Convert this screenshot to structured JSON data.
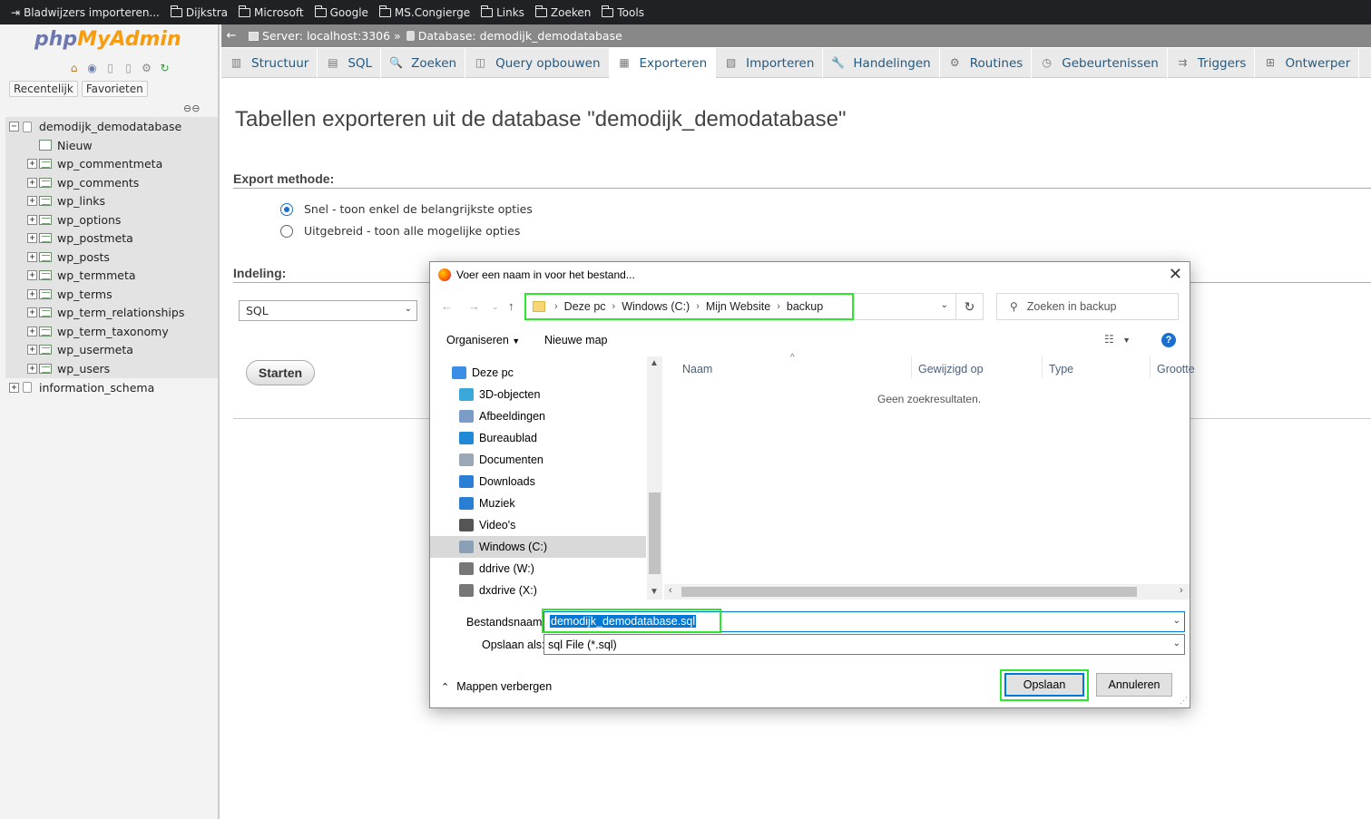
{
  "bookmarks": [
    {
      "label": "Bladwijzers importeren...",
      "icon": "import-icon"
    },
    {
      "label": "Dijkstra",
      "icon": "folder-icon"
    },
    {
      "label": "Microsoft",
      "icon": "folder-icon"
    },
    {
      "label": "Google",
      "icon": "folder-icon"
    },
    {
      "label": "MS.Congierge",
      "icon": "folder-icon"
    },
    {
      "label": "Links",
      "icon": "folder-icon"
    },
    {
      "label": "Zoeken",
      "icon": "folder-icon"
    },
    {
      "label": "Tools",
      "icon": "folder-icon"
    }
  ],
  "sidebar": {
    "logo_php": "php",
    "logo_myadmin": "MyAdmin",
    "tabs": [
      "Recentelijk",
      "Favorieten"
    ],
    "db_selected": "demodijk_demodatabase",
    "new_label": "Nieuw",
    "tables": [
      "wp_commentmeta",
      "wp_comments",
      "wp_links",
      "wp_options",
      "wp_postmeta",
      "wp_posts",
      "wp_termmeta",
      "wp_terms",
      "wp_term_relationships",
      "wp_term_taxonomy",
      "wp_usermeta",
      "wp_users"
    ],
    "db_other": "information_schema"
  },
  "breadcrumb": {
    "server": "Server: localhost:3306",
    "sep": "»",
    "database": "Database: demodijk_demodatabase"
  },
  "tabs": [
    {
      "label": "Structuur",
      "icon": "structure-icon"
    },
    {
      "label": "SQL",
      "icon": "sql-icon"
    },
    {
      "label": "Zoeken",
      "icon": "search-icon"
    },
    {
      "label": "Query opbouwen",
      "icon": "query-icon"
    },
    {
      "label": "Exporteren",
      "icon": "export-icon",
      "active": true
    },
    {
      "label": "Importeren",
      "icon": "import-icon"
    },
    {
      "label": "Handelingen",
      "icon": "wrench-icon"
    },
    {
      "label": "Routines",
      "icon": "routines-icon"
    },
    {
      "label": "Gebeurtenissen",
      "icon": "clock-icon"
    },
    {
      "label": "Triggers",
      "icon": "triggers-icon"
    },
    {
      "label": "Ontwerper",
      "icon": "designer-icon"
    }
  ],
  "main": {
    "title": "Tabellen exporteren uit de database \"demodijk_demodatabase\"",
    "export_method_label": "Export methode:",
    "opt_quick": "Snel - toon enkel de belangrijkste opties",
    "opt_custom": "Uitgebreid - toon alle mogelijke opties",
    "format_label": "Indeling:",
    "format_value": "SQL",
    "go_button": "Starten"
  },
  "dialog": {
    "title": "Voer een naam in voor het bestand...",
    "path": [
      "Deze pc",
      "Windows (C:)",
      "Mijn Website",
      "backup"
    ],
    "search_placeholder": "Zoeken in backup",
    "organize": "Organiseren",
    "new_folder": "Nieuwe map",
    "nav_items": [
      {
        "label": "Deze pc",
        "icon": "computer-icon",
        "color": "#3a8ee6"
      },
      {
        "label": "3D-objecten",
        "icon": "cube-icon",
        "color": "#39a7d9"
      },
      {
        "label": "Afbeeldingen",
        "icon": "pictures-icon",
        "color": "#7a9cc6"
      },
      {
        "label": "Bureaublad",
        "icon": "desktop-icon",
        "color": "#1e8ad6"
      },
      {
        "label": "Documenten",
        "icon": "documents-icon",
        "color": "#9aa7b5"
      },
      {
        "label": "Downloads",
        "icon": "downloads-icon",
        "color": "#2a7fd4"
      },
      {
        "label": "Muziek",
        "icon": "music-icon",
        "color": "#2a7fd4"
      },
      {
        "label": "Video's",
        "icon": "video-icon",
        "color": "#555555"
      },
      {
        "label": "Windows (C:)",
        "icon": "drive-c-icon",
        "color": "#8aa0b6",
        "selected": true
      },
      {
        "label": "ddrive (W:)",
        "icon": "drive-icon",
        "color": "#777777"
      },
      {
        "label": "dxdrive (X:)",
        "icon": "drive-icon",
        "color": "#777777"
      }
    ],
    "columns": [
      "Naam",
      "Gewijzigd op",
      "Type",
      "Grootte"
    ],
    "empty_message": "Geen zoekresultaten.",
    "filename_label": "Bestandsnaam:",
    "filename_value": "demodijk_demodatabase.sql",
    "savetype_label": "Opslaan als:",
    "savetype_value": "sql File (*.sql)",
    "hide_folders": "Mappen verbergen",
    "save_button": "Opslaan",
    "cancel_button": "Annuleren"
  }
}
